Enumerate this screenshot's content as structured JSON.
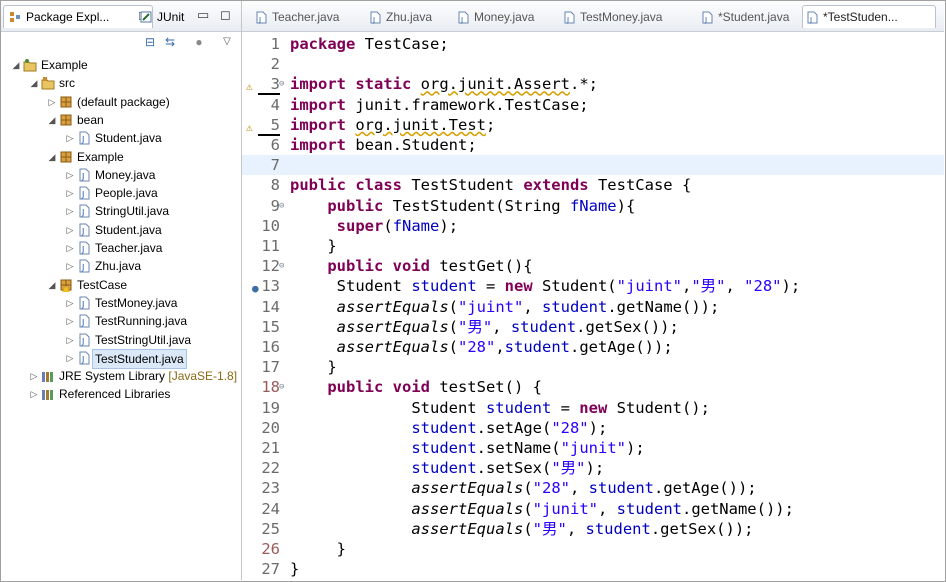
{
  "left_panel": {
    "tabs": [
      {
        "label": "Package Expl...",
        "close": "☒"
      },
      {
        "label": "JUnit"
      }
    ],
    "tree": [
      {
        "label": "Example",
        "depth": 0,
        "icon": "project-icon",
        "twisty": "◢"
      },
      {
        "label": "src",
        "depth": 1,
        "icon": "source-folder-icon",
        "twisty": "◢"
      },
      {
        "label": "(default package)",
        "depth": 2,
        "icon": "package-icon",
        "twisty": "▷"
      },
      {
        "label": "bean",
        "depth": 2,
        "icon": "package-icon",
        "twisty": "◢"
      },
      {
        "label": "Student.java",
        "depth": 3,
        "icon": "java-file-icon",
        "twisty": "▷"
      },
      {
        "label": "Example",
        "depth": 2,
        "icon": "package-icon",
        "twisty": "◢"
      },
      {
        "label": "Money.java",
        "depth": 3,
        "icon": "java-file-icon",
        "twisty": "▷"
      },
      {
        "label": "People.java",
        "depth": 3,
        "icon": "java-file-icon",
        "twisty": "▷"
      },
      {
        "label": "StringUtil.java",
        "depth": 3,
        "icon": "java-file-icon",
        "twisty": "▷"
      },
      {
        "label": "Student.java",
        "depth": 3,
        "icon": "java-file-icon",
        "twisty": "▷"
      },
      {
        "label": "Teacher.java",
        "depth": 3,
        "icon": "java-file-icon",
        "twisty": "▷"
      },
      {
        "label": "Zhu.java",
        "depth": 3,
        "icon": "java-file-icon",
        "twisty": "▷"
      },
      {
        "label": "TestCase",
        "depth": 2,
        "icon": "package-warn-icon",
        "twisty": "◢"
      },
      {
        "label": "TestMoney.java",
        "depth": 3,
        "icon": "java-file-icon",
        "twisty": "▷"
      },
      {
        "label": "TestRunning.java",
        "depth": 3,
        "icon": "java-file-icon",
        "twisty": "▷"
      },
      {
        "label": "TestStringUtil.java",
        "depth": 3,
        "icon": "java-file-icon",
        "twisty": "▷"
      },
      {
        "label": "TestStudent.java",
        "depth": 3,
        "icon": "java-file-icon",
        "twisty": "▷",
        "selected": true
      },
      {
        "label": "JRE System Library",
        "suffix": "[JavaSE-1.8]",
        "depth": 1,
        "icon": "library-icon",
        "twisty": "▷"
      },
      {
        "label": "Referenced Libraries",
        "depth": 1,
        "icon": "library-icon",
        "twisty": "▷"
      }
    ]
  },
  "editor": {
    "tabs": [
      "Teacher.java",
      "Zhu.java",
      "Money.java",
      "TestMoney.java",
      "*Student.java",
      "*TestStuden..."
    ],
    "lines": [
      [
        [
          "k",
          "package"
        ],
        [
          "t",
          " TestCase;"
        ]
      ],
      [],
      [
        [
          "k",
          "import static"
        ],
        [
          "t",
          " "
        ],
        [
          "u",
          "org.junit.Assert"
        ],
        [
          "t",
          ".*;"
        ]
      ],
      [
        [
          "k",
          "import"
        ],
        [
          "t",
          " junit.framework.TestCase;"
        ]
      ],
      [
        [
          "k",
          "import"
        ],
        [
          "t",
          " "
        ],
        [
          "u",
          "org.junit.Test"
        ],
        [
          "t",
          ";"
        ]
      ],
      [
        [
          "k",
          "import"
        ],
        [
          "t",
          " bean.Student;"
        ]
      ],
      [],
      [
        [
          "k",
          "public class"
        ],
        [
          "t",
          " TestStudent "
        ],
        [
          "k",
          "extends"
        ],
        [
          "t",
          " TestCase {"
        ]
      ],
      [
        [
          "t",
          "    "
        ],
        [
          "k",
          "public"
        ],
        [
          "t",
          " TestStudent(String "
        ],
        [
          "f",
          "fName"
        ],
        [
          "t",
          "){"
        ]
      ],
      [
        [
          "t",
          "     "
        ],
        [
          "k",
          "super"
        ],
        [
          "t",
          "("
        ],
        [
          "f",
          "fName"
        ],
        [
          "t",
          ");"
        ]
      ],
      [
        [
          "t",
          "    }"
        ]
      ],
      [
        [
          "t",
          "    "
        ],
        [
          "k",
          "public void"
        ],
        [
          "t",
          " testGet(){"
        ]
      ],
      [
        [
          "t",
          "     Student "
        ],
        [
          "f",
          "student"
        ],
        [
          "t",
          " = "
        ],
        [
          "k",
          "new"
        ],
        [
          "t",
          " Student("
        ],
        [
          "s",
          "\"juint\""
        ],
        [
          "t",
          ","
        ],
        [
          "s",
          "\"男\""
        ],
        [
          "t",
          ", "
        ],
        [
          "s",
          "\"28\""
        ],
        [
          "t",
          ");"
        ]
      ],
      [
        [
          "t",
          "     "
        ],
        [
          "i",
          "assertEquals"
        ],
        [
          "t",
          "("
        ],
        [
          "s",
          "\"juint\""
        ],
        [
          "t",
          ", "
        ],
        [
          "f",
          "student"
        ],
        [
          "t",
          ".getName());"
        ]
      ],
      [
        [
          "t",
          "     "
        ],
        [
          "i",
          "assertEquals"
        ],
        [
          "t",
          "("
        ],
        [
          "s",
          "\"男\""
        ],
        [
          "t",
          ", "
        ],
        [
          "f",
          "student"
        ],
        [
          "t",
          ".getSex());"
        ]
      ],
      [
        [
          "t",
          "     "
        ],
        [
          "i",
          "assertEquals"
        ],
        [
          "t",
          "("
        ],
        [
          "s",
          "\"28\""
        ],
        [
          "t",
          ","
        ],
        [
          "f",
          "student"
        ],
        [
          "t",
          ".getAge());"
        ]
      ],
      [
        [
          "t",
          "    }"
        ]
      ],
      [
        [
          "t",
          "    "
        ],
        [
          "k",
          "public void"
        ],
        [
          "t",
          " testSet() {"
        ]
      ],
      [
        [
          "t",
          "             Student "
        ],
        [
          "f",
          "student"
        ],
        [
          "t",
          " = "
        ],
        [
          "k",
          "new"
        ],
        [
          "t",
          " Student();"
        ]
      ],
      [
        [
          "t",
          "             "
        ],
        [
          "f",
          "student"
        ],
        [
          "t",
          ".setAge("
        ],
        [
          "s",
          "\"28\""
        ],
        [
          "t",
          ");"
        ]
      ],
      [
        [
          "t",
          "             "
        ],
        [
          "f",
          "student"
        ],
        [
          "t",
          ".setName("
        ],
        [
          "s",
          "\"junit\""
        ],
        [
          "t",
          ");"
        ]
      ],
      [
        [
          "t",
          "             "
        ],
        [
          "f",
          "student"
        ],
        [
          "t",
          ".setSex("
        ],
        [
          "s",
          "\"男\""
        ],
        [
          "t",
          ");"
        ]
      ],
      [
        [
          "t",
          "             "
        ],
        [
          "i",
          "assertEquals"
        ],
        [
          "t",
          "("
        ],
        [
          "s",
          "\"28\""
        ],
        [
          "t",
          ", "
        ],
        [
          "f",
          "student"
        ],
        [
          "t",
          ".getAge());"
        ]
      ],
      [
        [
          "t",
          "             "
        ],
        [
          "i",
          "assertEquals"
        ],
        [
          "t",
          "("
        ],
        [
          "s",
          "\"junit\""
        ],
        [
          "t",
          ", "
        ],
        [
          "f",
          "student"
        ],
        [
          "t",
          ".getName());"
        ]
      ],
      [
        [
          "t",
          "             "
        ],
        [
          "i",
          "assertEquals"
        ],
        [
          "t",
          "("
        ],
        [
          "s",
          "\"男\""
        ],
        [
          "t",
          ", "
        ],
        [
          "f",
          "student"
        ],
        [
          "t",
          ".getSex());"
        ]
      ],
      [
        [
          "t",
          "     }"
        ]
      ],
      [
        [
          "t",
          "}"
        ]
      ]
    ],
    "line_numbers": [
      "1",
      "2",
      "3",
      "4",
      "5",
      "6",
      "7",
      "8",
      "9",
      "10",
      "11",
      "12",
      "13",
      "14",
      "15",
      "16",
      "17",
      "18",
      "19",
      "20",
      "21",
      "22",
      "23",
      "24",
      "25",
      "26",
      "27"
    ],
    "colors": {
      "keyword": "#7f0055",
      "string": "#2a00ff",
      "field": "#0000c0",
      "current_line": "#e8f2fe"
    }
  }
}
